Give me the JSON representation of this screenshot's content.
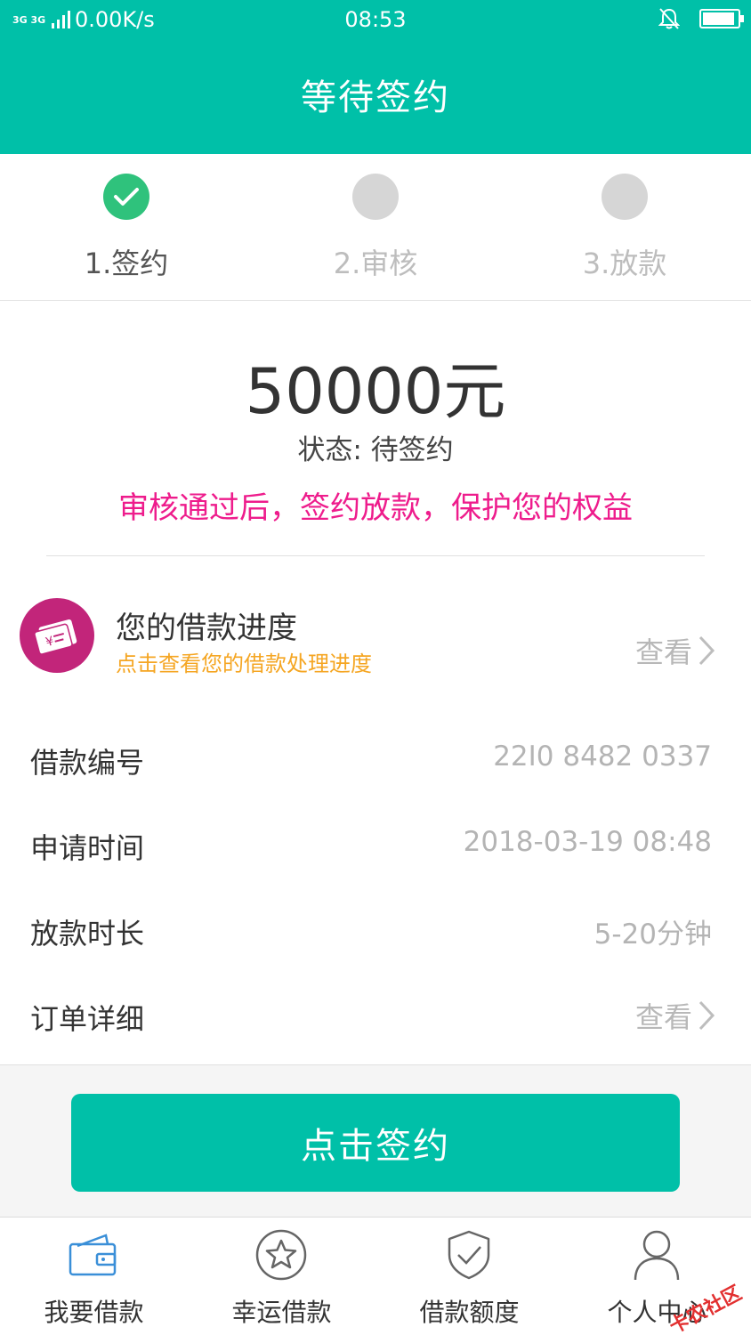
{
  "status_bar": {
    "network": "3G 3G",
    "speed": "0.00K/s",
    "time": "08:53",
    "battery_level": 0.92
  },
  "header": {
    "title": "等待签约"
  },
  "steps": [
    {
      "label": "1.签约",
      "state": "done"
    },
    {
      "label": "2.审核",
      "state": "pending"
    },
    {
      "label": "3.放款",
      "state": "pending"
    }
  ],
  "summary": {
    "amount": "50000元",
    "status": "状态: 待签约",
    "notice": "审核通过后，签约放款，保护您的权益"
  },
  "progress": {
    "title": "您的借款进度",
    "subtitle": "点击查看您的借款处理进度",
    "link": "查看"
  },
  "details": [
    {
      "label": "借款编号",
      "value": "22I0 8482 0337"
    },
    {
      "label": "申请时间",
      "value": "2018-03-19 08:48"
    },
    {
      "label": "放款时长",
      "value": "5-20分钟"
    },
    {
      "label": "订单详细",
      "value": "查看"
    }
  ],
  "action": {
    "sign_label": "点击签约"
  },
  "tabs": [
    {
      "label": "我要借款",
      "icon": "wallet-icon"
    },
    {
      "label": "幸运借款",
      "icon": "star-icon"
    },
    {
      "label": "借款额度",
      "icon": "shield-icon"
    },
    {
      "label": "个人中心",
      "icon": "user-icon"
    }
  ],
  "watermark": "卡农社区",
  "colors": {
    "primary": "#00c0a8",
    "step_done": "#2fc27c",
    "step_pending": "#d6d6d6",
    "notice": "#ee1c8c",
    "subtitle": "#f5a623",
    "progress_icon": "#c2257a"
  }
}
